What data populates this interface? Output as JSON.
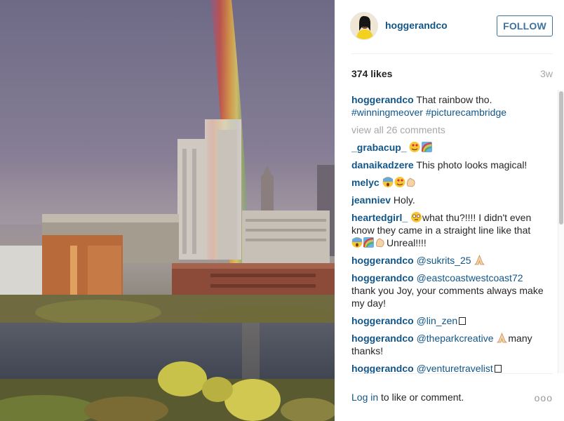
{
  "post": {
    "username": "hoggerandco",
    "follow_label": "FOLLOW",
    "likes": "374 likes",
    "age": "3w"
  },
  "caption": {
    "user": "hoggerandco",
    "text": "That rainbow tho.",
    "hashtags": [
      "#winningmeover",
      "#picturecambridge"
    ]
  },
  "view_all": "view all 26 comments",
  "comments": [
    {
      "user": "_grabacup_",
      "text": " ",
      "emoji": [
        "heart-eyes-emoji",
        "rainbow-emoji"
      ]
    },
    {
      "user": "danaikadzere",
      "text": " This photo looks magical!"
    },
    {
      "user": "melyc",
      "text": " ",
      "emoji": [
        "scream-emoji",
        "heart-eyes-emoji",
        "clap-emoji"
      ]
    },
    {
      "user": "jeanniev",
      "text": " Holy."
    },
    {
      "user": "heartedgirl_",
      "text_pre": "what thu?!!!! I didn't even know they came in a straight line like that ",
      "text_post": "Unreal!!!!"
    },
    {
      "user": "hoggerandco",
      "mention": "@sukrits_25"
    },
    {
      "user": "hoggerandco",
      "mention": "@eastcoastwestcoast72",
      "text": " thank you Joy, your comments always make my day!"
    },
    {
      "user": "hoggerandco",
      "mention": "@lin_zen"
    },
    {
      "user": "hoggerandco",
      "mention": "@theparkcreative",
      "text": "many thanks!"
    },
    {
      "user": "hoggerandco",
      "mention": "@venturetravelist"
    }
  ],
  "footer": {
    "login_link": "Log in",
    "login_rest": " to like or comment.",
    "more": "ooo"
  }
}
